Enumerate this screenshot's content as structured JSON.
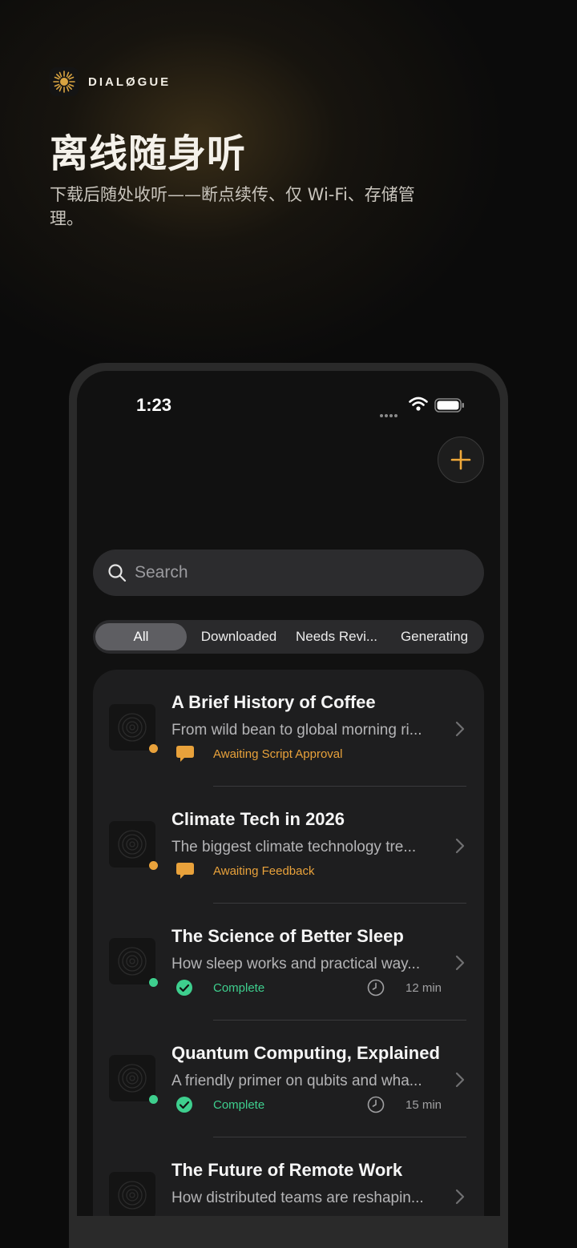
{
  "brand": {
    "name": "DIALØGUE",
    "logo_icon": "sunburst-icon"
  },
  "hero": {
    "headline": "离线随身听",
    "subhead": "下载后随处收听——断点续传、仅 Wi-Fi、存储管理。"
  },
  "status_bar": {
    "time": "1:23"
  },
  "search": {
    "placeholder": "Search"
  },
  "filters": {
    "tabs": [
      {
        "label": "All",
        "active": true
      },
      {
        "label": "Downloaded",
        "active": false
      },
      {
        "label": "Needs Revi...",
        "active": false
      },
      {
        "label": "Generating",
        "active": false
      }
    ]
  },
  "colors": {
    "accent": "#f0a93a",
    "pending": "#e9a23b",
    "complete": "#3ecf8e"
  },
  "episodes": [
    {
      "title": "A Brief History of Coffee",
      "description": "From wild bean to global morning ri...",
      "status": "Awaiting Script Approval",
      "status_type": "pending",
      "duration": ""
    },
    {
      "title": "Climate Tech in 2026",
      "description": "The biggest climate technology tre...",
      "status": "Awaiting Feedback",
      "status_type": "pending",
      "duration": ""
    },
    {
      "title": "The Science of Better Sleep",
      "description": "How sleep works and practical way...",
      "status": "Complete",
      "status_type": "complete",
      "duration": "12 min"
    },
    {
      "title": "Quantum Computing, Explained",
      "description": "A friendly primer on qubits and wha...",
      "status": "Complete",
      "status_type": "complete",
      "duration": "15 min"
    },
    {
      "title": "The Future of Remote Work",
      "description": "How distributed teams are reshapin...",
      "status": "",
      "status_type": "complete",
      "duration": ""
    }
  ]
}
